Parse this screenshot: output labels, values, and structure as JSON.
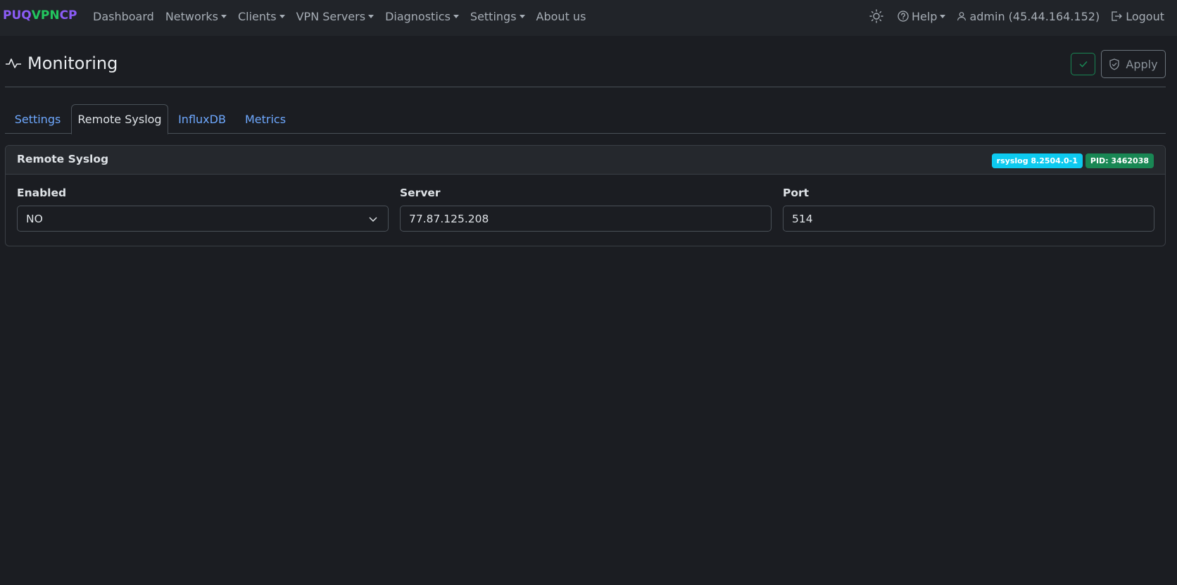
{
  "brand": {
    "p1": "PUQ",
    "p2": "VPN",
    "p3": "CP",
    "c1": "#8b5cf6",
    "c2": "#22c55e",
    "c3": "#8b5cf6"
  },
  "nav": {
    "items": [
      {
        "label": "Dashboard",
        "dropdown": false
      },
      {
        "label": "Networks",
        "dropdown": true
      },
      {
        "label": "Clients",
        "dropdown": true
      },
      {
        "label": "VPN Servers",
        "dropdown": true
      },
      {
        "label": "Diagnostics",
        "dropdown": true
      },
      {
        "label": "Settings",
        "dropdown": true
      },
      {
        "label": "About us",
        "dropdown": false
      }
    ],
    "theme_icon": "sun-icon",
    "help_label": "Help",
    "user_label": "admin (45.44.164.152)",
    "logout_label": "Logout"
  },
  "page": {
    "title": "Monitoring",
    "title_icon": "activity-icon",
    "apply_label": "Apply"
  },
  "tabs": [
    {
      "label": "Settings",
      "active": false
    },
    {
      "label": "Remote Syslog",
      "active": true
    },
    {
      "label": "InfluxDB",
      "active": false
    },
    {
      "label": "Metrics",
      "active": false
    }
  ],
  "card": {
    "title": "Remote Syslog",
    "badge_version": "rsyslog 8.2504.0-1",
    "badge_pid": "PID: 3462038",
    "fields": {
      "enabled_label": "Enabled",
      "enabled_value": "NO",
      "server_label": "Server",
      "server_value": "77.87.125.208",
      "port_label": "Port",
      "port_value": "514"
    }
  }
}
